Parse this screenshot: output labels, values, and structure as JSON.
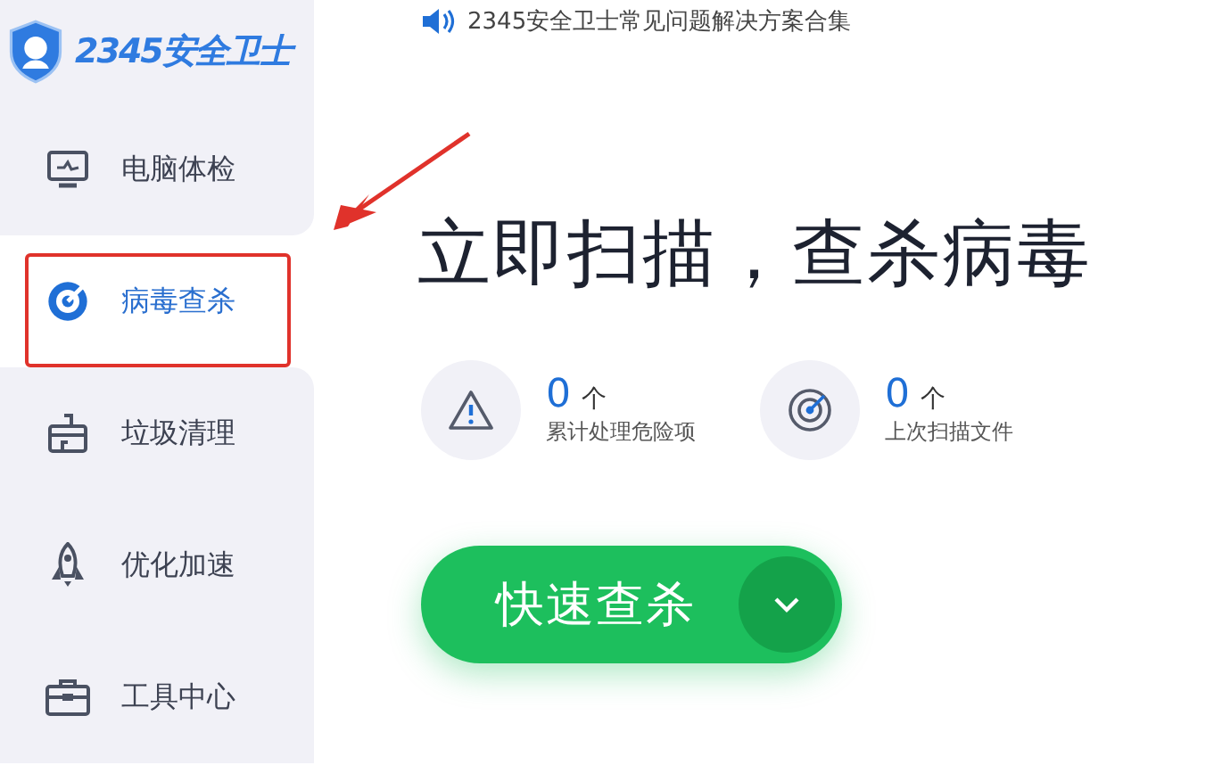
{
  "logo": {
    "text": "2345安全卫士"
  },
  "nav": [
    {
      "label": "电脑体检",
      "kind": "monitor",
      "selected": false,
      "highlighted": false
    },
    {
      "label": "病毒查杀",
      "kind": "target",
      "selected": true,
      "highlighted": true
    },
    {
      "label": "垃圾清理",
      "kind": "broom",
      "selected": false,
      "highlighted": false
    },
    {
      "label": "优化加速",
      "kind": "rocket",
      "selected": false,
      "highlighted": false
    },
    {
      "label": "工具中心",
      "kind": "toolbox",
      "selected": false,
      "highlighted": false
    }
  ],
  "notice": "2345安全卫士常见问题解决方案合集",
  "heading": "立即扫描，查杀病毒",
  "stats": [
    {
      "kind": "warning",
      "count": "0",
      "unit": "个",
      "label": "累计处理危险项"
    },
    {
      "kind": "radar",
      "count": "0",
      "unit": "个",
      "label": "上次扫描文件"
    }
  ],
  "scan_button": {
    "label": "快速查杀"
  }
}
